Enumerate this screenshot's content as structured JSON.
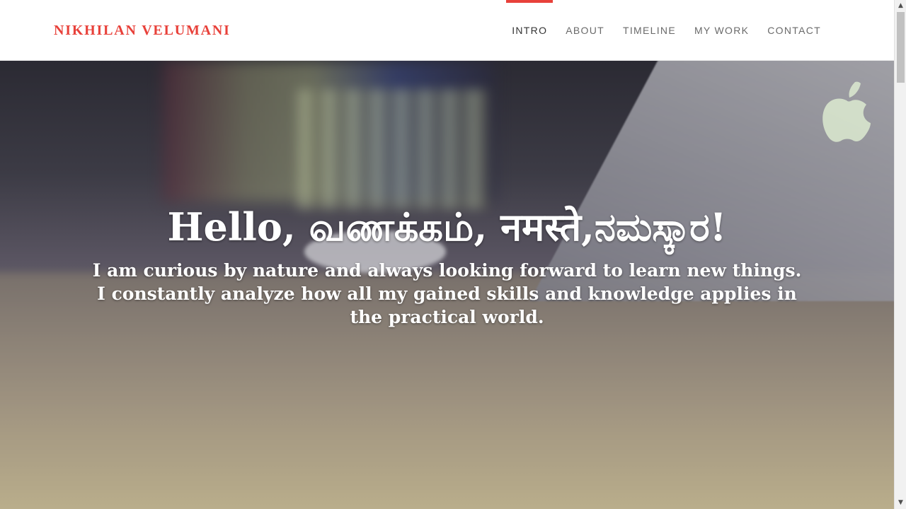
{
  "header": {
    "brand": "NIKHILAN VELUMANI",
    "nav": [
      {
        "label": "INTRO",
        "active": true
      },
      {
        "label": "ABOUT",
        "active": false
      },
      {
        "label": "TIMELINE",
        "active": false
      },
      {
        "label": "MY WORK",
        "active": false
      },
      {
        "label": "CONTACT",
        "active": false
      }
    ]
  },
  "hero": {
    "title": "Hello, வணக்கம், नमस्ते,ನಮಸ್ಕಾರ!",
    "subtitle_line1": "I am curious by nature and always looking forward to learn new things.",
    "subtitle_line2": "I constantly analyze how all my gained skills and knowledge applies in the practical world."
  },
  "icons": {
    "apple_logo": "apple-logo",
    "scroll_up": "chevron-up-icon",
    "scroll_down": "chevron-down-icon"
  },
  "colors": {
    "accent": "#e8413a",
    "nav_text": "#6a6a6a",
    "hero_text": "#ffffff"
  }
}
